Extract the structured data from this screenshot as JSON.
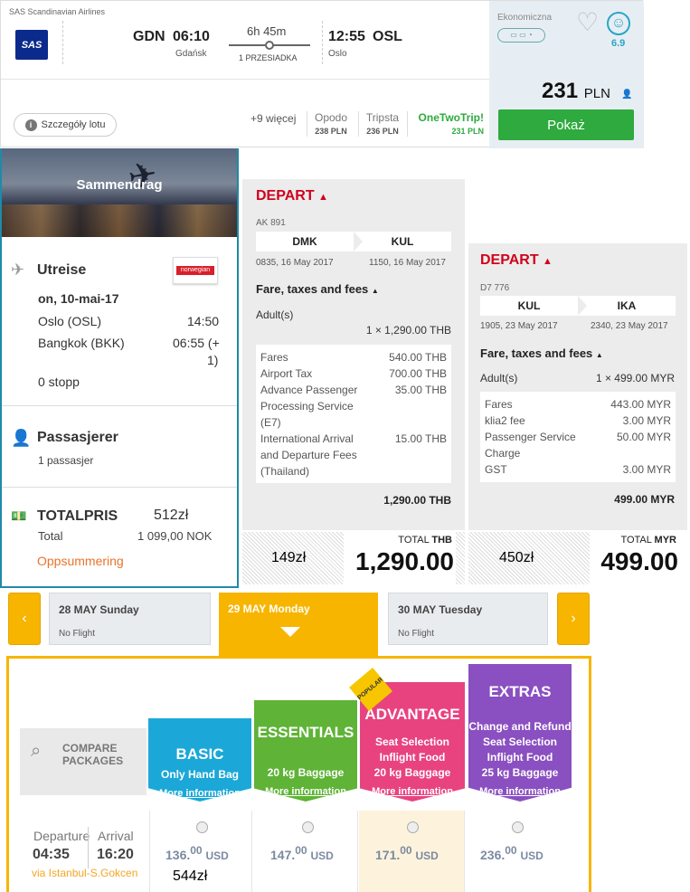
{
  "card": {
    "airline": "SAS Scandinavian Airlines",
    "logo_text": "SAS",
    "from_code": "GDN",
    "from_time": "06:10",
    "from_city": "Gdańsk",
    "duration": "6h 45m",
    "stops": "1 PRZESIADKA",
    "to_time": "12:55",
    "to_code": "OSL",
    "to_city": "Oslo",
    "details_label": "Szczegóły lotu",
    "more": "+9 więcej",
    "providers": [
      {
        "name": "Opodo",
        "price": "238 PLN"
      },
      {
        "name": "Tripsta",
        "price": "236 PLN"
      },
      {
        "name": "OneTwoTrip!",
        "price": "231 PLN"
      }
    ],
    "cabin": "Ekonomiczna",
    "score": "6.9",
    "price": "231",
    "currency": "PLN",
    "show_label": "Pokaż"
  },
  "summary": {
    "title": "Sammendrag",
    "outbound_label": "Utreise",
    "airline_logo": "norwegian",
    "date": "on, 10-mai-17",
    "from": "Oslo (OSL)",
    "from_time": "14:50",
    "to": "Bangkok (BKK)",
    "to_time": "06:55 (+",
    "to_time2": "1)",
    "stops": "0 stopp",
    "passengers_label": "Passasjerer",
    "passengers": "1 passasjer",
    "total_label": "TOTALPRIS",
    "total_pln": "512zł",
    "total_sub": "Total",
    "total_nok": "1 099,00 NOK",
    "summary_link": "Oppsummering"
  },
  "depart1": {
    "title": "DEPART",
    "flight": "AK 891",
    "from": "DMK",
    "to": "KUL",
    "dep_time": "0835, 16 May 2017",
    "arr_time": "1150, 16 May 2017",
    "fare_header": "Fare, taxes and fees",
    "adult": "Adult(s)",
    "mult": "1 × 1,290.00 THB",
    "items": [
      {
        "label": "Fares",
        "value": "540.00 THB"
      },
      {
        "label": "Airport Tax",
        "value": "700.00 THB"
      },
      {
        "label": "Advance Passenger Processing Service (E7)",
        "value": "35.00 THB"
      },
      {
        "label": "International Arrival and Departure Fees (Thailand)",
        "value": "15.00 THB"
      }
    ],
    "subtotal": "1,290.00 THB",
    "pln": "149zł",
    "total_label": "TOTAL",
    "total_cur": "THB",
    "total": "1,290.00"
  },
  "depart2": {
    "title": "DEPART",
    "flight": "D7 776",
    "from": "KUL",
    "to": "IKA",
    "dep_time": "1905, 23 May 2017",
    "arr_time": "2340, 23 May 2017",
    "fare_header": "Fare, taxes and fees",
    "adult": "Adult(s)",
    "mult": "1 × 499.00 MYR",
    "items": [
      {
        "label": "Fares",
        "value": "443.00 MYR"
      },
      {
        "label": "klia2 fee",
        "value": "3.00 MYR"
      },
      {
        "label": "Passenger Service Charge",
        "value": "50.00 MYR"
      },
      {
        "label": "GST",
        "value": "3.00 MYR"
      }
    ],
    "subtotal": "499.00 MYR",
    "pln": "450zł",
    "total_label": "TOTAL",
    "total_cur": "MYR",
    "total": "499.00"
  },
  "dates": {
    "prev": "28 MAY Sunday",
    "prev_note": "No Flight",
    "current": "29 MAY Monday",
    "next": "30 MAY Tuesday",
    "next_note": "No Flight"
  },
  "packages": {
    "compare": "COMPARE PACKAGES",
    "popular": "POPULAR",
    "basic": {
      "name": "BASIC",
      "lines": [
        "Only Hand Bag"
      ],
      "more": "More information",
      "price": "136.",
      "cents": "00",
      "cur": "USD"
    },
    "essentials": {
      "name": "ESSENTIALS",
      "lines": [
        "20 kg Baggage"
      ],
      "more": "More information",
      "price": "147.",
      "cents": "00",
      "cur": "USD"
    },
    "advantage": {
      "name": "ADVANTAGE",
      "lines": [
        "Seat Selection",
        "Inflight Food",
        "20 kg Baggage"
      ],
      "more": "More information",
      "price": "171.",
      "cents": "00",
      "cur": "USD"
    },
    "extras": {
      "name": "EXTRAS",
      "lines": [
        "Change and Refund",
        "Seat Selection",
        "Inflight Food",
        "25 kg Baggage"
      ],
      "more": "More information",
      "price": "236.",
      "cents": "00",
      "cur": "USD"
    },
    "departure_label": "Departure",
    "arrival_label": "Arrival",
    "dep_time": "04:35",
    "arr_time": "16:20",
    "via": "via Istanbul-S.Gokcen",
    "pln": "544zł"
  },
  "colors": {
    "accent_green": "#2eaa3e",
    "depart_red": "#d0021b",
    "yellow": "#f7b500",
    "basic": "#1ba8d8",
    "essentials": "#5fb336",
    "advantage": "#e8437e",
    "extras": "#8a4fc0"
  }
}
